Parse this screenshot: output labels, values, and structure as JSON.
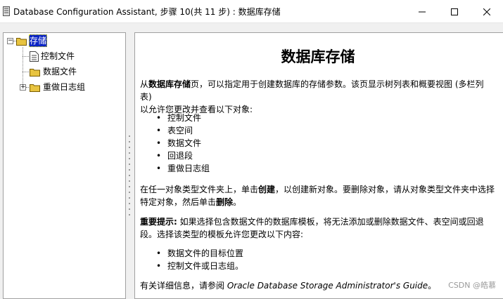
{
  "window": {
    "title": "Database Configuration Assistant, 步骤 10(共 11 步) : 数据库存储"
  },
  "tree": {
    "root": {
      "label": "存储"
    },
    "items": [
      {
        "label": "控制文件"
      },
      {
        "label": "数据文件"
      },
      {
        "label": "重做日志组"
      }
    ]
  },
  "help": {
    "title": "数据库存储",
    "intro_pre": "从",
    "intro_bold": "数据库存储",
    "intro_line1_rest": "页，可以指定用于创建数据库的存储参数。该页显示树列表和概要视图 (多栏列表)",
    "intro_line2": "以允许您更改并查看以下对象:",
    "objects": [
      "控制文件",
      "表空间",
      "数据文件",
      "回退段",
      "重做日志组"
    ],
    "create_pre": "在任一对象类型文件夹上，单击",
    "create_bold": "创建",
    "create_mid": "，以创建新对象。要删除对象，请从对象类型文件夹中选择",
    "create_line2_pre": "特定对象，然后单击",
    "create_line2_bold": "删除",
    "create_line2_end": "。",
    "tip_bold": "重要提示:",
    "tip_line1_rest": " 如果选择包含数据文件的数据库模板，将无法添加或删除数据文件、表空间或回退",
    "tip_line2": "段。选择该类型的模板允许您更改以下内容:",
    "changes": [
      "数据文件的目标位置",
      "控制文件或日志组。"
    ],
    "more_pre": "有关详细信息，请参阅 ",
    "more_italic": "Oracle Database Storage Administrator's Guide",
    "more_end": "。"
  },
  "watermark": "CSDN @皓慕",
  "colors": {
    "selection": "#0a24c4",
    "folder": "#e8c440"
  },
  "icons": {
    "app": "app-icon",
    "folder": "folder-icon",
    "document": "document-icon"
  }
}
